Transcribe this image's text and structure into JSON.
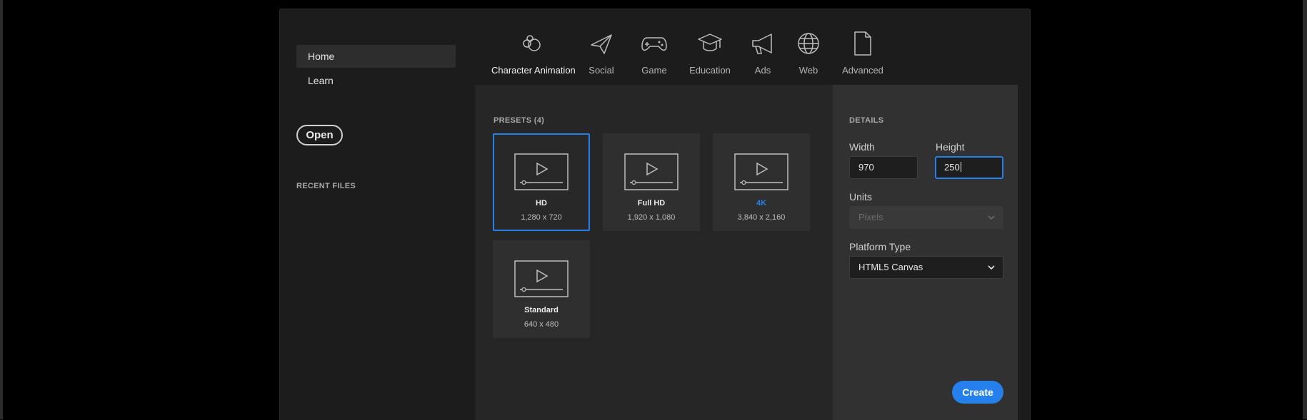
{
  "sidebar": {
    "items": [
      {
        "label": "Home",
        "active": true
      },
      {
        "label": "Learn",
        "active": false
      }
    ],
    "open_label": "Open",
    "recent_label": "RECENT FILES"
  },
  "tabs": [
    {
      "label": "Character Animation",
      "icon": "character-animation-icon",
      "active": true
    },
    {
      "label": "Social",
      "icon": "paper-plane-icon"
    },
    {
      "label": "Game",
      "icon": "gamepad-icon"
    },
    {
      "label": "Education",
      "icon": "graduation-cap-icon"
    },
    {
      "label": "Ads",
      "icon": "megaphone-icon"
    },
    {
      "label": "Web",
      "icon": "globe-icon"
    },
    {
      "label": "Advanced",
      "icon": "document-icon"
    }
  ],
  "presets": {
    "label": "PRESETS (4)",
    "items": [
      {
        "name": "HD",
        "dims": "1,280 x 720",
        "selected": true
      },
      {
        "name": "Full HD",
        "dims": "1,920 x 1,080"
      },
      {
        "name": "4K",
        "dims": "3,840 x 2,160"
      },
      {
        "name": "Standard",
        "dims": "640 x 480"
      }
    ]
  },
  "details": {
    "label": "DETAILS",
    "width_label": "Width",
    "width_value": "970",
    "height_label": "Height",
    "height_value": "250",
    "units_label": "Units",
    "units_value": "Pixels",
    "platform_label": "Platform Type",
    "platform_value": "HTML5 Canvas",
    "create_label": "Create"
  },
  "colors": {
    "accent": "#2680eb",
    "background": "#1c1c1c",
    "panel": "#262626",
    "details_panel": "#313131"
  }
}
